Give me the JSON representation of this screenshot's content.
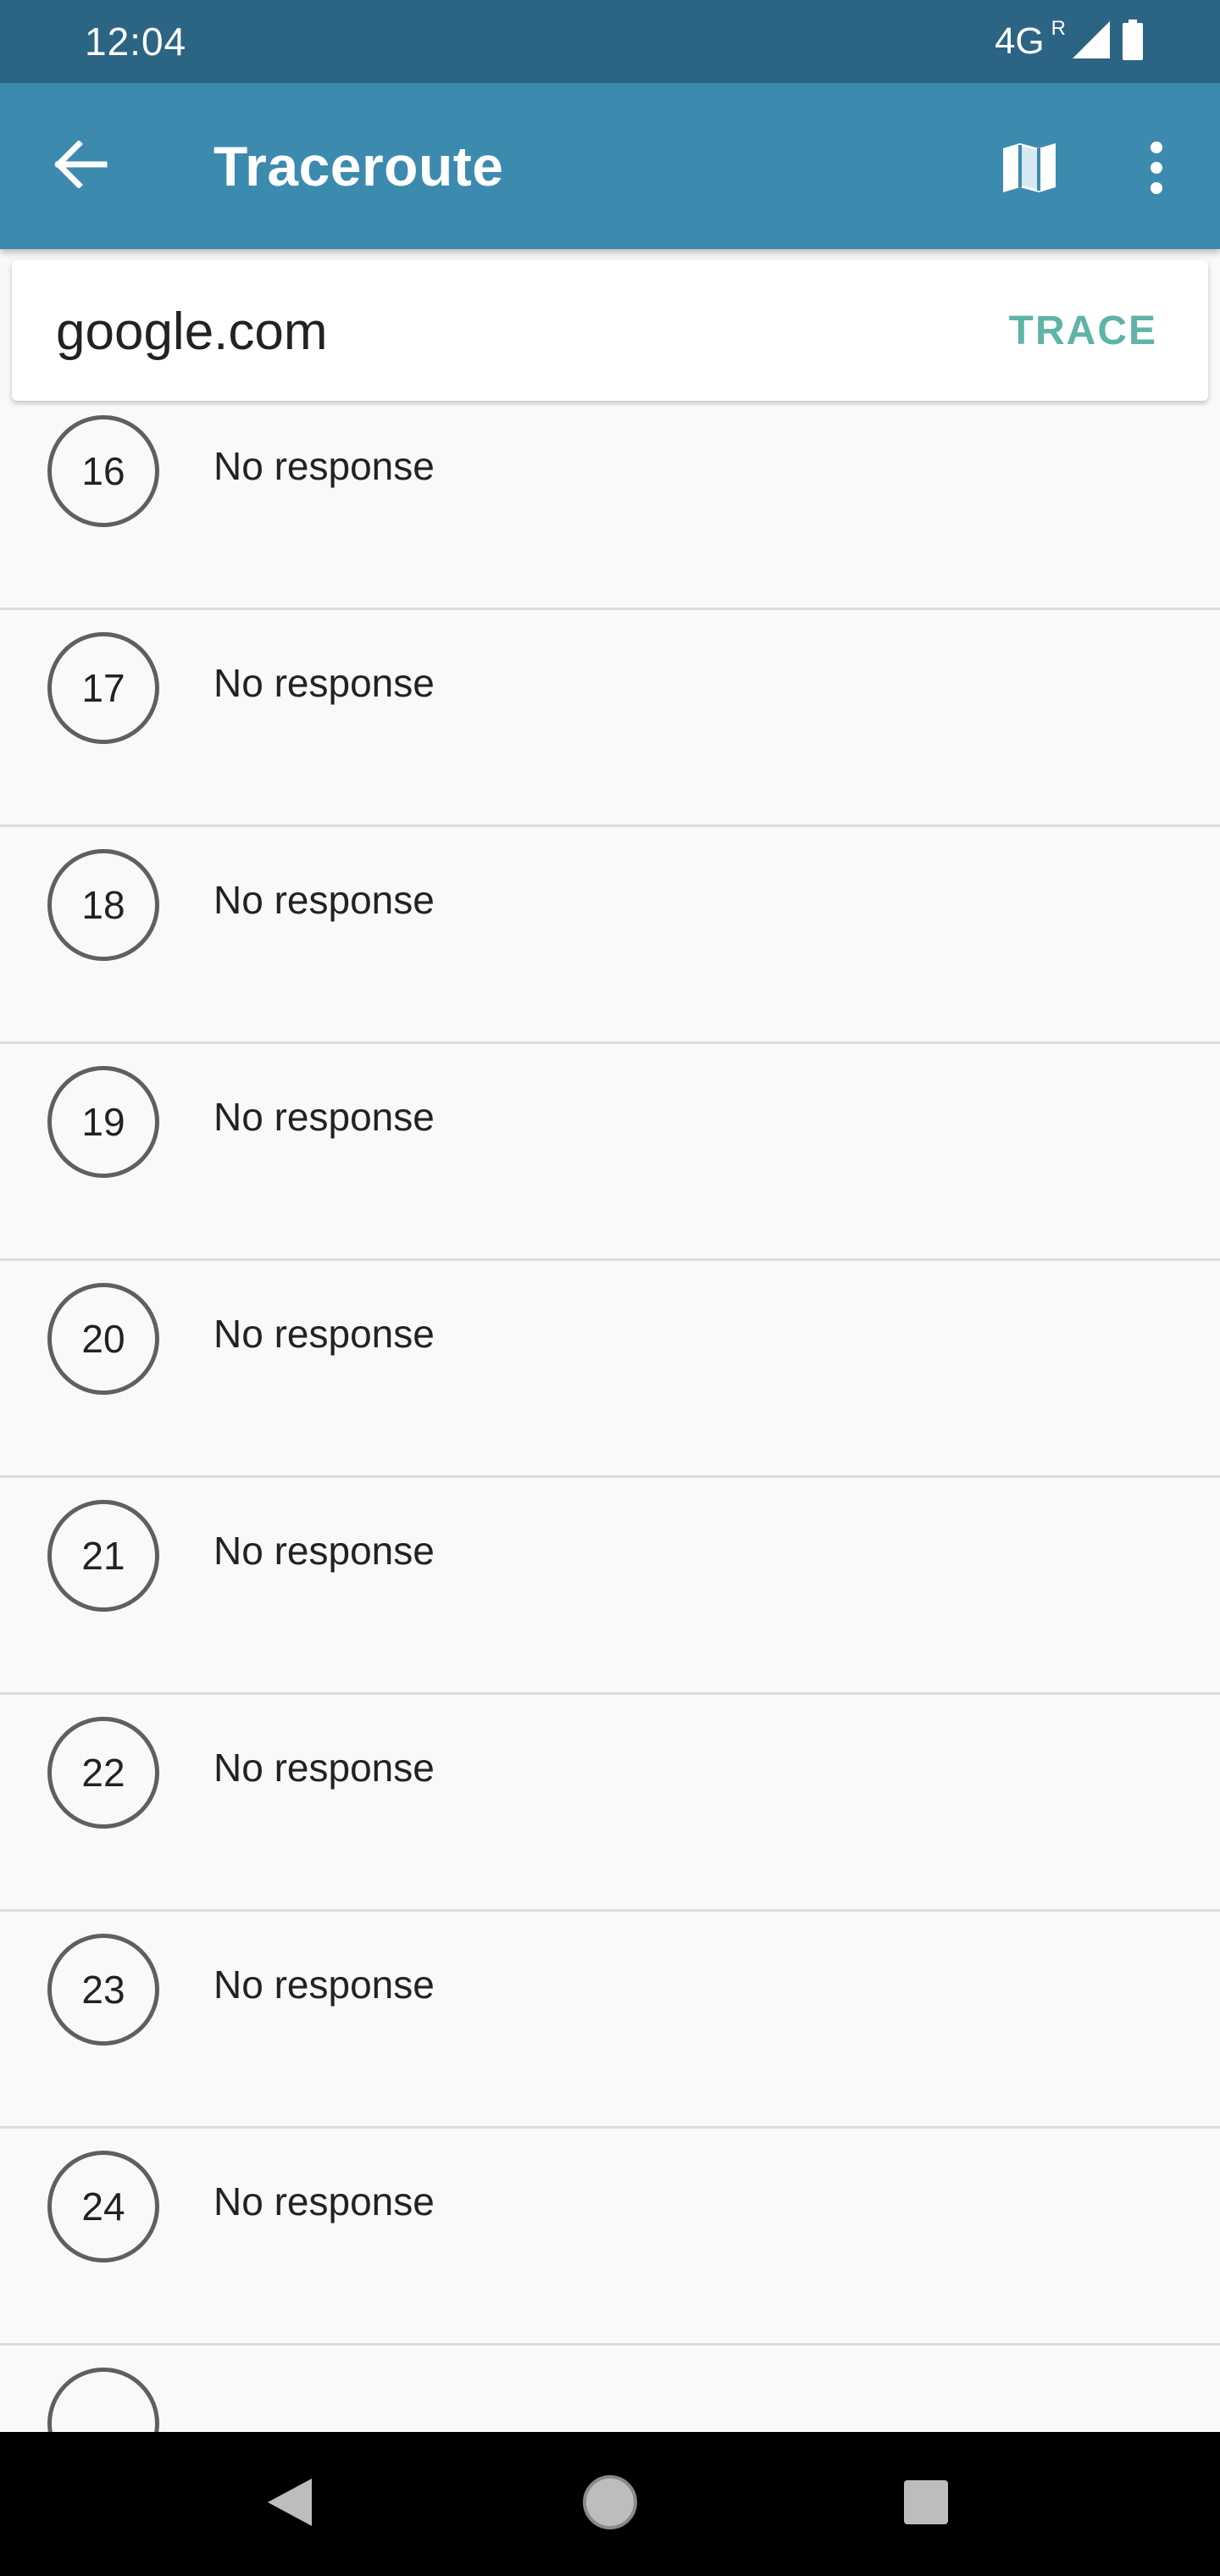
{
  "status_bar": {
    "time": "12:04",
    "network": "4G",
    "roaming": "R",
    "icons": [
      "signal-icon",
      "battery-icon"
    ]
  },
  "app_bar": {
    "title": "Traceroute",
    "icons": {
      "back": "arrow-left-icon",
      "map": "map-icon",
      "more": "more-vert-icon"
    }
  },
  "search": {
    "value": "google.com",
    "button_label": "TRACE"
  },
  "hops": [
    {
      "number": "16",
      "status": "No response"
    },
    {
      "number": "17",
      "status": "No response"
    },
    {
      "number": "18",
      "status": "No response"
    },
    {
      "number": "19",
      "status": "No response"
    },
    {
      "number": "20",
      "status": "No response"
    },
    {
      "number": "21",
      "status": "No response"
    },
    {
      "number": "22",
      "status": "No response"
    },
    {
      "number": "23",
      "status": "No response"
    },
    {
      "number": "24",
      "status": "No response"
    }
  ],
  "nav_bar": {
    "icons": [
      "back-triangle-icon",
      "home-circle-icon",
      "recents-square-icon"
    ]
  },
  "colors": {
    "status_bar": "#2c6483",
    "app_bar": "#3d8aaf",
    "accent": "#5fb3a8",
    "background": "#f9f9f9"
  }
}
